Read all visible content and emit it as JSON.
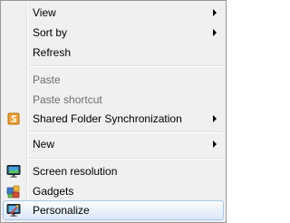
{
  "menu": {
    "items": [
      {
        "label": "View",
        "has_submenu": true,
        "disabled": false
      },
      {
        "label": "Sort by",
        "has_submenu": true,
        "disabled": false
      },
      {
        "label": "Refresh",
        "has_submenu": false,
        "disabled": false
      },
      {
        "label": "Paste",
        "has_submenu": false,
        "disabled": true
      },
      {
        "label": "Paste shortcut",
        "has_submenu": false,
        "disabled": true
      },
      {
        "label": "Shared Folder Synchronization",
        "has_submenu": true,
        "disabled": false,
        "icon": "shared-folder-sync-icon"
      },
      {
        "label": "New",
        "has_submenu": true,
        "disabled": false
      },
      {
        "label": "Screen resolution",
        "has_submenu": false,
        "disabled": false,
        "icon": "screen-resolution-icon"
      },
      {
        "label": "Gadgets",
        "has_submenu": false,
        "disabled": false,
        "icon": "gadgets-icon"
      },
      {
        "label": "Personalize",
        "has_submenu": false,
        "disabled": false,
        "icon": "personalize-icon",
        "highlighted": true
      }
    ]
  },
  "colors": {
    "menu_background": "#f0f0f0",
    "menu_border": "#979797",
    "highlight_border": "#a8c8eb",
    "disabled_text": "#6d6d6d",
    "accent_orange": "#f0a030"
  }
}
